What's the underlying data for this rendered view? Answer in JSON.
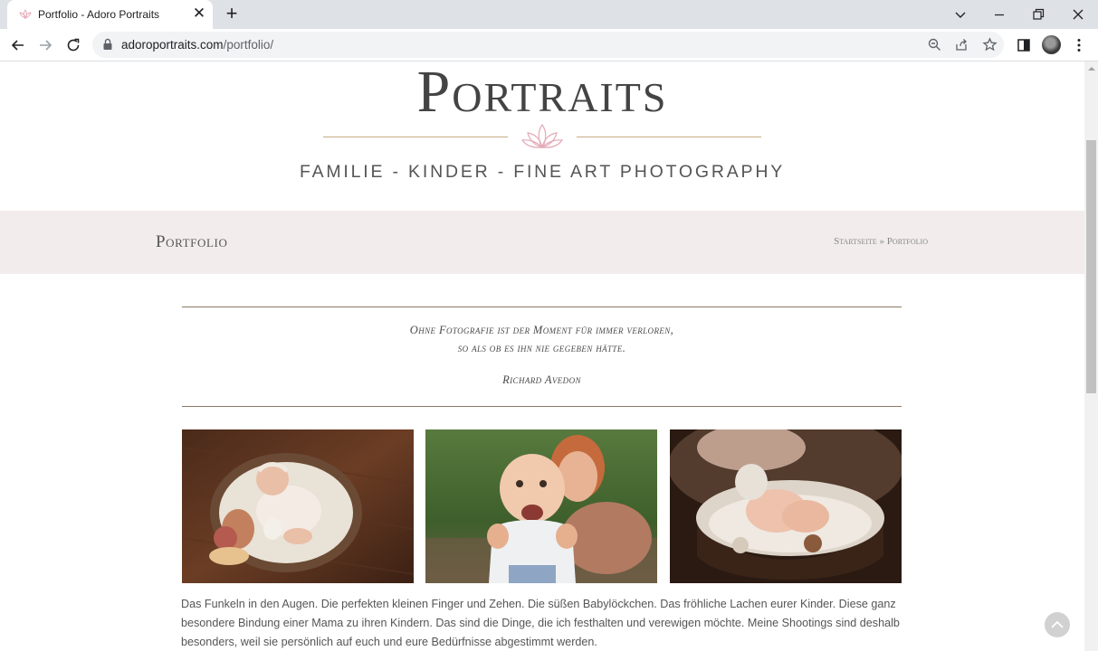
{
  "browser": {
    "tab_title": "Portfolio - Adoro Portraits",
    "url_domain": "adoroportraits.com",
    "url_path": "/portfolio/",
    "icons": [
      "favicon-lotus",
      "close-icon",
      "plus-icon",
      "chevron-down-icon",
      "minimize-icon",
      "restore-icon",
      "window-close-icon",
      "back-arrow-icon",
      "forward-arrow-icon",
      "reload-icon",
      "lock-icon",
      "zoom-icon",
      "share-icon",
      "star-icon",
      "side-panel-icon",
      "profile-avatar",
      "menu-dots-icon"
    ]
  },
  "site": {
    "logo_word": "Portraits",
    "tagline": "FAMILIE - KINDER - FINE ART PHOTOGRAPHY",
    "accent_color": "#c6ab83",
    "lotus_color": "#e3a9b6",
    "band_color": "#f2ecec"
  },
  "page": {
    "title": "Portfolio",
    "breadcrumb": {
      "home": "Startseite",
      "separator": "»",
      "current": "Portfolio"
    }
  },
  "quote": {
    "line1": "Ohne Fotografie ist der Moment für immer verloren,",
    "line2": "so als ob es ihn nie gegeben hätte.",
    "author": "Richard Avedon"
  },
  "photos": [
    {
      "name": "photo-newborn-basket",
      "subject": "newborn in wooden basket"
    },
    {
      "name": "photo-mother-baby",
      "subject": "laughing baby held by mother"
    },
    {
      "name": "photo-newborn-feet",
      "subject": "newborn feet in bowl"
    }
  ],
  "intro_text": "Das Funkeln in den Augen. Die perfekten kleinen Finger und Zehen. Die süßen Babylöckchen. Das fröhliche Lachen eurer Kinder. Diese ganz besondere Bindung einer Mama zu ihren Kindern. Das sind die Dinge, die ich festhalten und verewigen möchte. Meine Shootings sind deshalb besonders, weil sie persönlich auf euch und eure Bedürfnisse abgestimmt werden."
}
